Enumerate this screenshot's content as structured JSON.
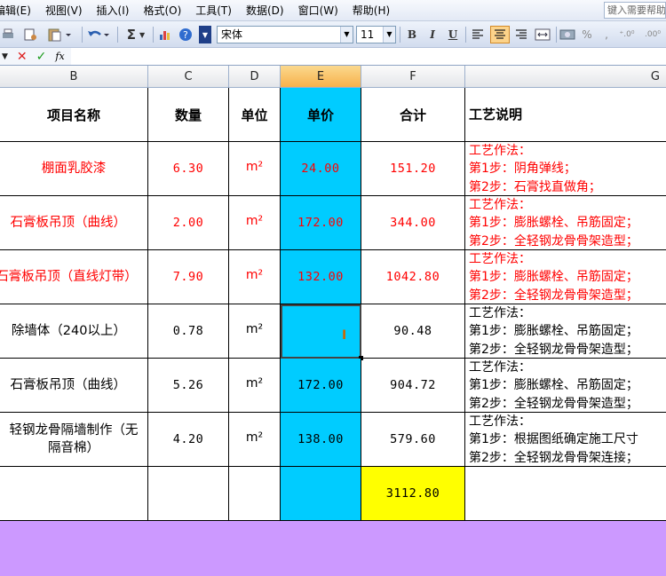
{
  "menu": {
    "items": [
      "编辑(E)",
      "视图(V)",
      "插入(I)",
      "格式(O)",
      "工具(T)",
      "数据(D)",
      "窗口(W)",
      "帮助(H)"
    ],
    "help_placeholder": "键入需要帮助的问题"
  },
  "toolbar": {
    "font_name": "宋体",
    "font_size": "11",
    "bold_label": "B",
    "italic_label": "I",
    "underline_label": "U",
    "sum_label": "Σ",
    "percent_label": "%"
  },
  "formula_bar": {
    "fx_label": "fx",
    "value": ""
  },
  "columns": [
    "B",
    "C",
    "D",
    "E",
    "F",
    "G"
  ],
  "selected_column": "E",
  "table": {
    "headers": {
      "name": "项目名称",
      "qty": "数量",
      "unit": "单位",
      "price": "单价",
      "total": "合计",
      "desc": "工艺说明"
    },
    "rows": [
      {
        "name": "棚面乳胶漆",
        "qty": "6.30",
        "unit": "m²",
        "price": "24.00",
        "total": "151.20",
        "desc1": "工艺作法：",
        "desc2": "第1步：阴角弹线；",
        "desc3": "第2步：石膏找直做角；"
      },
      {
        "name": "石膏板吊顶（曲线）",
        "qty": "2.00",
        "unit": "m²",
        "price": "172.00",
        "total": "344.00",
        "desc1": "工艺作法：",
        "desc2": "第1步：膨胀螺栓、吊筋固定；",
        "desc3": "第2步：全轻钢龙骨骨架造型；"
      },
      {
        "name": "石膏板吊顶（直线灯带）",
        "qty": "7.90",
        "unit": "m²",
        "price": "132.00",
        "total": "1042.80",
        "desc1": "工艺作法：",
        "desc2": "第1步：膨胀螺栓、吊筋固定；",
        "desc3": "第2步：全轻钢龙骨骨架造型；"
      },
      {
        "name": "除墙体（240以上）",
        "qty": "0.78",
        "unit": "m²",
        "price": "",
        "total": "90.48",
        "desc1": "工艺作法：",
        "desc2": "第1步：膨胀螺栓、吊筋固定；",
        "desc3": "第2步：全轻钢龙骨骨架造型；"
      },
      {
        "name": "石膏板吊顶（曲线）",
        "qty": "5.26",
        "unit": "m²",
        "price": "172.00",
        "total": "904.72",
        "desc1": "工艺作法：",
        "desc2": "第1步：膨胀螺栓、吊筋固定；",
        "desc3": "第2步：全轻钢龙骨骨架造型；"
      },
      {
        "name": "轻钢龙骨隔墙制作（无隔音棉）",
        "qty": "4.20",
        "unit": "m²",
        "price": "138.00",
        "total": "579.60",
        "desc1": "工艺作法：",
        "desc2": "第1步：根据图纸确定施工尺寸",
        "desc3": "第2步：全轻钢龙骨骨架连接；"
      }
    ],
    "grand_total": "3112.80"
  },
  "colors": {
    "price_column": "#00ccff",
    "total_highlight": "#ffff00",
    "footer_band": "#cc99ff",
    "red_text": "#ff0000"
  }
}
